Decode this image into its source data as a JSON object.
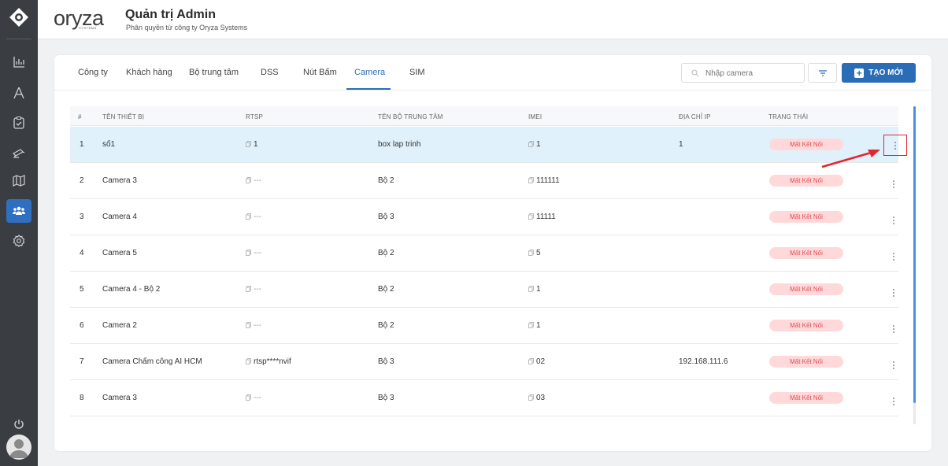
{
  "sidebar": {
    "nav_icons": [
      "chart-icon",
      "road-icon",
      "clipboard-icon",
      "camera-icon",
      "map-icon",
      "team-icon",
      "settings-icon"
    ],
    "bottom_icon": "power-icon"
  },
  "header": {
    "brand": "oryza",
    "brand_sub": "SYSTEMS",
    "title": "Quản trị Admin",
    "subtitle": "Phân quyền từ công ty Oryza Systems"
  },
  "tabs": [
    "Công ty",
    "Khách hàng",
    "Bộ trung tâm",
    "DSS",
    "Nút Bấm",
    "Camera",
    "SIM"
  ],
  "active_tab": "Camera",
  "search": {
    "placeholder": "Nhập camera"
  },
  "create_button": "TẠO MỚI",
  "table": {
    "headers": [
      "#",
      "TÊN THIẾT BỊ",
      "RTSP",
      "TÊN BỘ TRUNG TÂM",
      "IMEI",
      "ĐỊA CHỈ IP",
      "TRẠNG THÁI"
    ],
    "rows": [
      {
        "idx": "1",
        "name": "số1",
        "rtsp": "1",
        "center": "box lap trinh",
        "imei": "1",
        "ip": "1",
        "status": "Mất Kết Nối"
      },
      {
        "idx": "2",
        "name": "Camera 3",
        "rtsp": "---",
        "center": "Bộ 2",
        "imei": "111111",
        "ip": "",
        "status": "Mất Kết Nối"
      },
      {
        "idx": "3",
        "name": "Camera 4",
        "rtsp": "---",
        "center": "Bộ 3",
        "imei": "11111",
        "ip": "",
        "status": "Mất Kết Nối"
      },
      {
        "idx": "4",
        "name": "Camera 5",
        "rtsp": "---",
        "center": "Bộ 2",
        "imei": "5",
        "ip": "",
        "status": "Mất Kết Nối"
      },
      {
        "idx": "5",
        "name": "Camera 4 - Bộ 2",
        "rtsp": "---",
        "center": "Bộ 2",
        "imei": "1",
        "ip": "",
        "status": "Mất Kết Nối"
      },
      {
        "idx": "6",
        "name": "Camera 2",
        "rtsp": "---",
        "center": "Bộ 2",
        "imei": "1",
        "ip": "",
        "status": "Mất Kết Nối"
      },
      {
        "idx": "7",
        "name": "Camera Chấm công AI HCM",
        "rtsp": "rtsp****nvif",
        "center": "Bộ 3",
        "imei": "02",
        "ip": "192.168.111.6",
        "status": "Mất Kết Nối"
      },
      {
        "idx": "8",
        "name": "Camera 3",
        "rtsp": "---",
        "center": "Bộ 3",
        "imei": "03",
        "ip": "",
        "status": "Mất Kết Nối"
      }
    ]
  },
  "colors": {
    "primary": "#2a6db6",
    "sidebar": "#3a3d42",
    "selected_row": "#e0f1fb",
    "status_bg": "#ffd9da",
    "status_text": "#e24b51",
    "annotation": "#e0262f"
  }
}
